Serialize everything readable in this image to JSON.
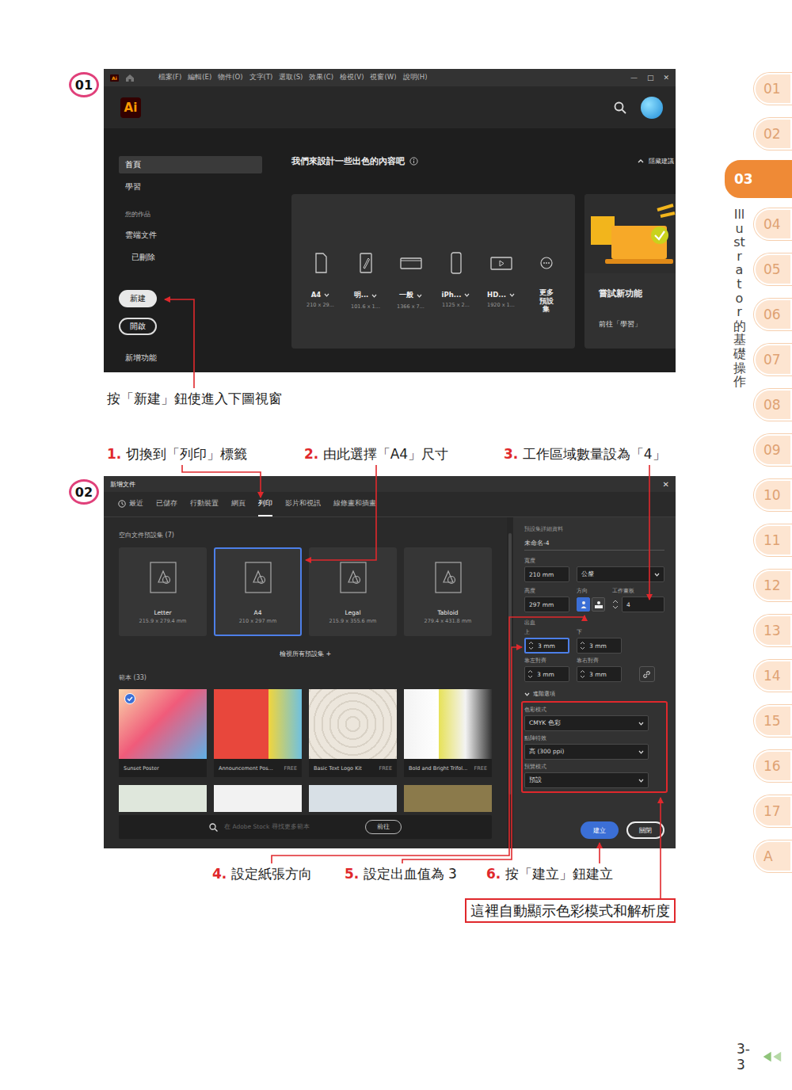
{
  "chapters": {
    "tabs": [
      {
        "label": "01",
        "selected": false
      },
      {
        "label": "02",
        "selected": false
      },
      {
        "label": "03",
        "selected": true
      },
      {
        "label": "04",
        "selected": false
      },
      {
        "label": "05",
        "selected": false
      },
      {
        "label": "06",
        "selected": false
      },
      {
        "label": "07",
        "selected": false
      },
      {
        "label": "08",
        "selected": false
      },
      {
        "label": "09",
        "selected": false
      },
      {
        "label": "10",
        "selected": false
      },
      {
        "label": "11",
        "selected": false
      },
      {
        "label": "12",
        "selected": false
      },
      {
        "label": "13",
        "selected": false
      },
      {
        "label": "14",
        "selected": false
      },
      {
        "label": "15",
        "selected": false
      },
      {
        "label": "16",
        "selected": false
      },
      {
        "label": "17",
        "selected": false
      },
      {
        "label": "A",
        "selected": false
      }
    ],
    "title": "Illustrator 的基礎操作"
  },
  "page_number": "3-3",
  "step1": {
    "badge": "01",
    "window": {
      "logo": "Ai",
      "menu": [
        "檔案(F)",
        "編輯(E)",
        "物件(O)",
        "文字(T)",
        "選取(S)",
        "效果(C)",
        "檢視(V)",
        "視窗(W)",
        "說明(H)"
      ],
      "controls": [
        "—",
        "□",
        "✕"
      ],
      "nav": [
        {
          "label": "首頁",
          "kind": "item",
          "selected": true
        },
        {
          "label": "學習",
          "kind": "item",
          "selected": false
        },
        {
          "label": "您的作品",
          "kind": "section",
          "selected": false
        },
        {
          "label": "雲端文件",
          "kind": "item",
          "selected": false
        },
        {
          "label": "已刪除",
          "kind": "subitem",
          "selected": false
        },
        {
          "label": "新建",
          "kind": "primary-button",
          "selected": false
        },
        {
          "label": "開啟",
          "kind": "outline-button",
          "selected": false
        },
        {
          "label": "新增功能",
          "kind": "item",
          "selected": false
        }
      ],
      "heading": "我們來設計一些出色的內容吧",
      "hide_suggestions": "隱藏建議",
      "presets": [
        {
          "name": "A4",
          "size": "210 x 29...",
          "kind": "document"
        },
        {
          "name": "明...",
          "size": "101.6 x 1...",
          "kind": "postcard"
        },
        {
          "name": "一般",
          "size": "1366 x 7...",
          "kind": "web"
        },
        {
          "name": "iPh...",
          "size": "1125 x 2...",
          "kind": "phone"
        },
        {
          "name": "HD...",
          "size": "1920 x 1...",
          "kind": "video"
        }
      ],
      "more_presets": "更多預設集",
      "feature_card": {
        "title": "嘗試新功能",
        "link": "前往「學習」"
      }
    },
    "caption": "按「新建」鈕使進入下圖視窗"
  },
  "step2": {
    "badge": "02",
    "callouts_top": [
      {
        "number": "1.",
        "text": "切換到「列印」標籤"
      },
      {
        "number": "2.",
        "text": "由此選擇「A4」尺寸"
      },
      {
        "number": "3.",
        "text": "工作區域數量設為「4」"
      }
    ],
    "window": {
      "title": "新增文件",
      "close": "✕",
      "tabs": [
        {
          "label": "最近",
          "selected": false
        },
        {
          "label": "已儲存",
          "selected": false
        },
        {
          "label": "行動裝置",
          "selected": false
        },
        {
          "label": "網頁",
          "selected": false
        },
        {
          "label": "列印",
          "selected": true
        },
        {
          "label": "影片和視訊",
          "selected": false
        },
        {
          "label": "線條畫和插畫",
          "selected": false
        }
      ],
      "blank_presets": {
        "heading": "空白文件預設集 (7)",
        "items": [
          {
            "name": "Letter",
            "size": "215.9 x 279.4 mm",
            "selected": false
          },
          {
            "name": "A4",
            "size": "210 x 297 mm",
            "selected": true
          },
          {
            "name": "Legal",
            "size": "215.9 x 355.6 mm",
            "selected": false
          },
          {
            "name": "Tabloid",
            "size": "279.4 x 431.8 mm",
            "selected": false
          }
        ]
      },
      "view_all": "檢視所有預設集 +",
      "templates": {
        "heading": "範本 (33)",
        "items": [
          {
            "name": "Sunset Poster",
            "selected": true
          },
          {
            "name": "Announcement Pos...",
            "tag": "FREE",
            "selected": false
          },
          {
            "name": "Basic Text Logo Kit",
            "tag": "FREE",
            "selected": false
          },
          {
            "name": "Bold and Bright Trifol...",
            "tag": "FREE",
            "selected": false
          }
        ]
      },
      "search": {
        "placeholder": "在 Adobe Stock 尋找更多範本",
        "button": "前往"
      },
      "details": {
        "heading": "預設集詳細資料",
        "name": "未命名-4",
        "width": {
          "label": "寬度",
          "value": "210 mm",
          "unit": "公釐"
        },
        "height": {
          "label": "高度",
          "value": "297 mm"
        },
        "orientation": {
          "label": "方向",
          "options": [
            {
              "kind": "portrait",
              "selected": true
            },
            {
              "kind": "landscape",
              "selected": false
            }
          ]
        },
        "artboards": {
          "label": "工作畫板",
          "value": "4"
        },
        "bleed": {
          "label": "出血",
          "fields": [
            {
              "label": "上",
              "value": "3 mm",
              "focused": true
            },
            {
              "label": "下",
              "value": "3 mm",
              "focused": false
            },
            {
              "label": "靠左對齊",
              "value": "3 mm",
              "focused": false
            },
            {
              "label": "靠右對齊",
              "value": "3 mm",
              "focused": false
            }
          ]
        },
        "advanced": "進階選項",
        "dropdowns": [
          {
            "label": "色彩模式",
            "value": "CMYK 色彩"
          },
          {
            "label": "點陣特效",
            "value": "高 (300 ppi)"
          },
          {
            "label": "預覽模式",
            "value": "預設"
          }
        ],
        "buttons": [
          {
            "label": "建立",
            "kind": "primary"
          },
          {
            "label": "關閉",
            "kind": "secondary"
          }
        ]
      }
    },
    "callouts_bottom": [
      {
        "number": "4.",
        "text": "設定紙張方向"
      },
      {
        "number": "5.",
        "text": "設定出血值為 3"
      },
      {
        "number": "6.",
        "text": "按「建立」鈕建立"
      }
    ],
    "note": "這裡自動顯示色彩模式和解析度"
  }
}
